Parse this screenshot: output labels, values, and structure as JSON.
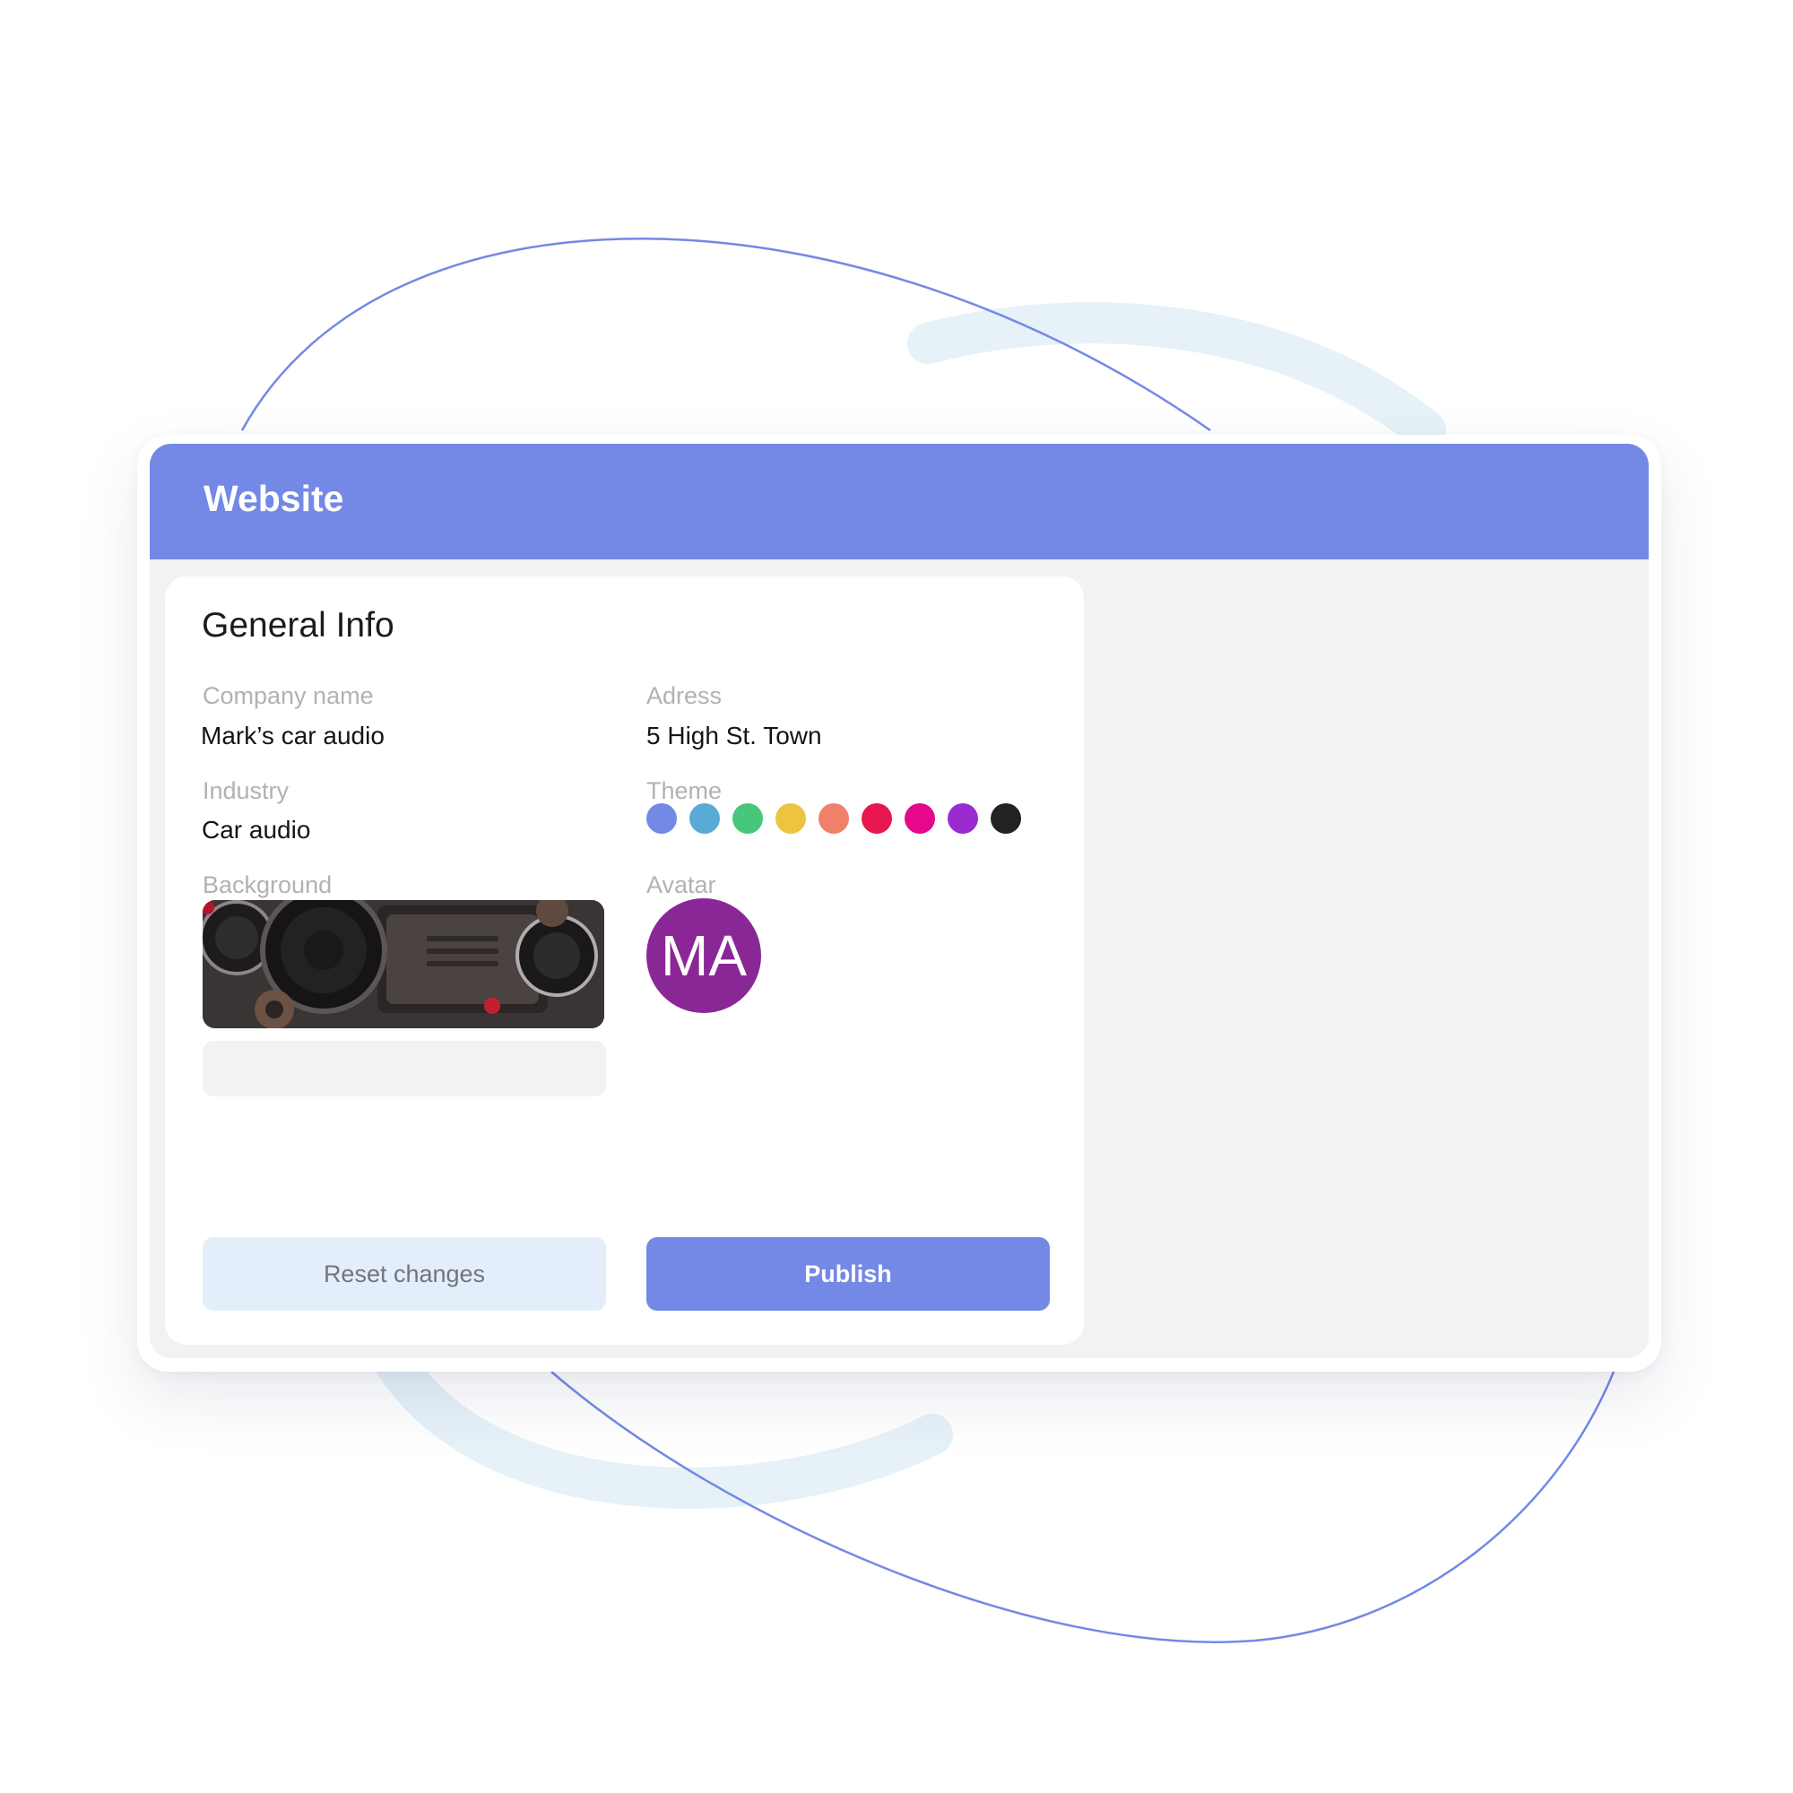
{
  "window": {
    "title": "Website",
    "header_color": "#7488e6"
  },
  "general_info": {
    "title": "General Info",
    "company_name": {
      "label": "Company name",
      "value": "Mark’s car audio"
    },
    "address": {
      "label": "Adress",
      "value": "5 High St. Town"
    },
    "industry": {
      "label": "Industry",
      "value": "Car audio"
    },
    "theme": {
      "label": "Theme",
      "colors": [
        "#7488e6",
        "#5aaad6",
        "#47c77c",
        "#ecc43f",
        "#f0806a",
        "#e8184e",
        "#e5088c",
        "#9a2ccf",
        "#222222"
      ]
    },
    "background": {
      "label": "Background",
      "image_icon": "car-audio-speakers-image"
    },
    "avatar": {
      "label": "Avatar",
      "initials": "MA",
      "color": "#8a2797"
    }
  },
  "actions": {
    "reset_label": "Reset changes",
    "publish_label": "Publish"
  }
}
